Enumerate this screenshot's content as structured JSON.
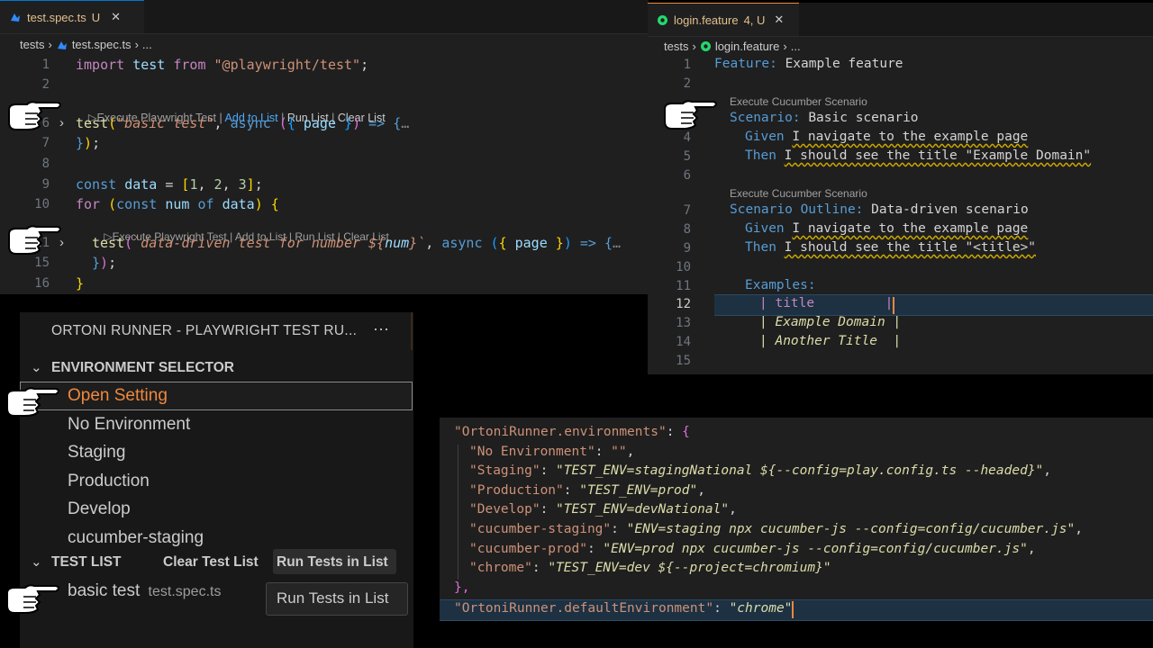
{
  "editor_left": {
    "tab": {
      "icon": "playwright-icon",
      "name": "test.spec.ts",
      "status": "U"
    },
    "breadcrumb": {
      "folder": "tests",
      "file": "test.spec.ts",
      "rest": "..."
    },
    "line_numbers": [
      "1",
      "2",
      "6",
      "7",
      "8",
      "9",
      "10",
      "11",
      "15",
      "16"
    ],
    "lens1": {
      "run": "Execute Playwright Test",
      "add": "Add to List",
      "runlist": "Run List",
      "clear": "Clear List"
    },
    "lens2": {
      "run": "Execute Playwright Test",
      "add": "Add to List",
      "runlist": "Run List",
      "clear": "Clear List"
    },
    "code": {
      "l1_kw": "import",
      "l1_name": "test",
      "l1_from": "from",
      "l1_str": "\"@playwright/test\"",
      "l1_end": ";",
      "l6_fn": "test",
      "l6_str": "\"basic test\"",
      "l6_async": "async",
      "l6_page": "page",
      "l6_rest": "=> {",
      "l7": "});",
      "l9_const": "const",
      "l9_var": "data",
      "l9_n1": "1",
      "l9_n2": "2",
      "l9_n3": "3",
      "l10_for": "for",
      "l10_const": "const",
      "l10_num": "num",
      "l10_of": "of",
      "l10_data": "data",
      "l11_fn": "test",
      "l11_str": "`data-driven test for number ${",
      "l11_var": "num",
      "l11_str2": "}`",
      "l11_async": "async",
      "l11_page": "page",
      "l15": "});",
      "l16": "}"
    }
  },
  "editor_right": {
    "tab": {
      "icon": "cucumber-icon",
      "name": "login.feature",
      "status": "4, U"
    },
    "breadcrumb": {
      "folder": "tests",
      "file": "login.feature",
      "rest": "..."
    },
    "line_numbers": [
      "1",
      "2",
      "3",
      "4",
      "5",
      "6",
      "7",
      "8",
      "9",
      "10",
      "11",
      "12",
      "13",
      "14",
      "15"
    ],
    "lens1": "Execute Cucumber Scenario",
    "lens2": "Execute Cucumber Scenario",
    "code": {
      "feature_kw": "Feature:",
      "feature_name": "Example feature",
      "scenario_kw": "Scenario:",
      "scenario_name": "Basic scenario",
      "given1_kw": "Given",
      "given1_text": "I navigate to the example page",
      "then1_kw": "Then",
      "then1_text": "I should see the title \"Example Domain\"",
      "outline_kw": "Scenario Outline:",
      "outline_name": "Data-driven scenario",
      "given2_kw": "Given",
      "given2_text": "I navigate to the example page",
      "then2_kw": "Then",
      "then2_text": "I should see the title \"<title>\"",
      "examples_kw": "Examples:",
      "table": [
        "| title         |",
        "| Example Domain |",
        "| Another Title  |"
      ]
    }
  },
  "sidebar": {
    "title": "ORTONI RUNNER - PLAYWRIGHT TEST RU...",
    "more": "···",
    "env_section": "ENVIRONMENT SELECTOR",
    "env_items": [
      "Open Setting",
      "No Environment",
      "Staging",
      "Production",
      "Develop",
      "cucumber-staging"
    ],
    "test_section": "TEST LIST",
    "clear_button": "Clear Test List",
    "run_button": "Run Tests in List",
    "test_item": {
      "name": "basic test",
      "file": "test.spec.ts"
    },
    "tooltip": "Run Tests in List"
  },
  "settings_json": {
    "key": "\"OrtoniRunner.environments\"",
    "entries": [
      {
        "k": "\"No Environment\"",
        "v": "\"\""
      },
      {
        "k": "\"Staging\"",
        "v": "\"TEST_ENV=stagingNational ${--config=play.config.ts --headed}\""
      },
      {
        "k": "\"Production\"",
        "v": "\"TEST_ENV=prod\""
      },
      {
        "k": "\"Develop\"",
        "v": "\"TEST_ENV=devNational\""
      },
      {
        "k": "\"cucumber-staging\"",
        "v": "\"ENV=staging npx cucumber-js --config=config/cucumber.js\""
      },
      {
        "k": "\"cucumber-prod\"",
        "v": "\"ENV=prod npx cucumber-js --config=config/cucumber.js\""
      },
      {
        "k": "\"chrome\"",
        "v": "\"TEST_ENV=dev ${--project=chromium}\""
      }
    ],
    "close": "},",
    "default_key": "\"OrtoniRunner.defaultEnvironment\"",
    "default_value": "\"chrome\""
  },
  "colors": {
    "accent": "#0078d4",
    "orange": "#f0883e",
    "string": "#ce9178",
    "keyword": "#c586c0"
  }
}
